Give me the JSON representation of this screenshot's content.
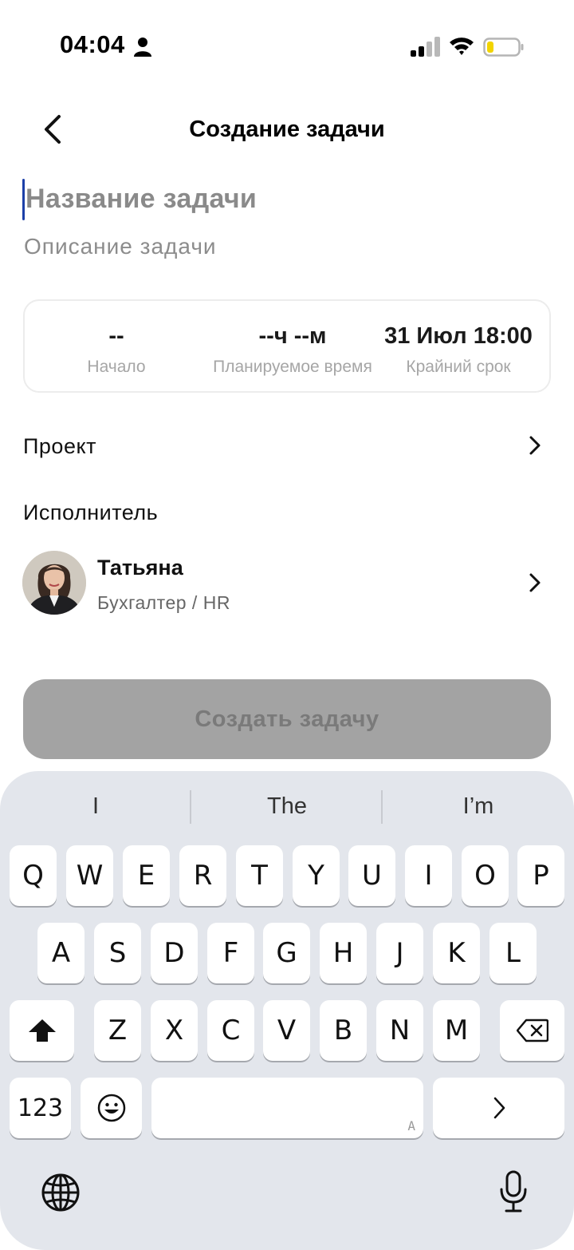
{
  "status_bar": {
    "time": "04:04",
    "icons": [
      "person-icon",
      "signal-icon",
      "wifi-icon",
      "battery-icon"
    ]
  },
  "header": {
    "title": "Создание задачи",
    "back_icon": "chevron-left-icon"
  },
  "form": {
    "title_placeholder": "Название задачи",
    "description_placeholder": "Описание задачи",
    "time_card": {
      "start": {
        "value": "--",
        "label": "Начало"
      },
      "planned": {
        "value": "--ч --м",
        "label": "Планируемое время"
      },
      "deadline": {
        "value": "31 Июл 18:00",
        "label": "Крайний срок"
      }
    },
    "project_label": "Проект",
    "assignee_heading": "Исполнитель",
    "assignee": {
      "name": "Татьяна",
      "role": "Бухгалтер / HR"
    },
    "create_button": "Создать задачу"
  },
  "keyboard": {
    "suggestions": [
      "I",
      "The",
      "I’m"
    ],
    "row1": [
      "Q",
      "W",
      "E",
      "R",
      "T",
      "Y",
      "U",
      "I",
      "O",
      "P"
    ],
    "row2": [
      "A",
      "S",
      "D",
      "F",
      "G",
      "H",
      "J",
      "K",
      "L"
    ],
    "row3": [
      "Z",
      "X",
      "C",
      "V",
      "B",
      "N",
      "M"
    ],
    "numbers_key": "123",
    "space_corner_label": "A",
    "icons": [
      "shift-icon",
      "backspace-icon",
      "emoji-icon",
      "return-icon",
      "globe-icon",
      "microphone-icon"
    ]
  },
  "colors": {
    "caret": "#1c3fa8",
    "button_disabled": "#a3a3a3",
    "keyboard_bg": "#e3e6ec",
    "battery_fill": "#f2d400"
  }
}
